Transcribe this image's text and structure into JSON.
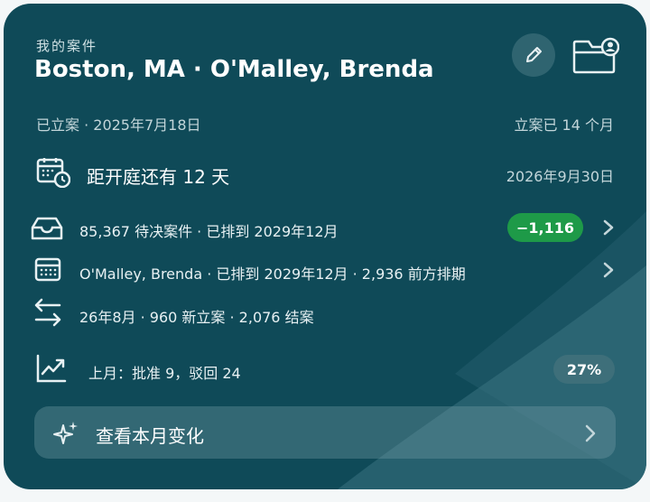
{
  "header": {
    "eyebrow": "我的案件",
    "title": "Boston, MA · O'Malley, Brenda",
    "icons": [
      "pencil-icon",
      "folder-person-icon"
    ]
  },
  "meta": {
    "filed": "已立案 · 2025年7月18日",
    "age": "立案已 14 个月"
  },
  "hearing": {
    "icon": "calendar-clock-icon",
    "countdown": "距开庭还有 12 天",
    "date": "2026年9月30日"
  },
  "rows": [
    {
      "icon": "inbox-tray-icon",
      "text": "85,367 待决案件 · 已排到 2029年12月",
      "badge": "−1,116",
      "badge_color": "#1e9a48",
      "has_chevron": true
    },
    {
      "icon": "calendar-icon",
      "text": "O'Malley, Brenda · 已排到 2029年12月 · 2,936 前方排期",
      "has_chevron": true
    },
    {
      "icon": "arrows-swap-icon",
      "text": "26年8月 · 960 新立案 · 2,076 结案",
      "has_chevron": false
    },
    {
      "icon": "trend-chart-icon",
      "text": "上月：批准 9，驳回 24",
      "badge": "27%",
      "badge_color": "#3e6f7a",
      "has_chevron": false
    }
  ],
  "action": {
    "icon": "sparkle-icon",
    "label": "查看本月变化"
  },
  "colors": {
    "card_bg": "#0f4a58",
    "accent_green": "#1e9a48",
    "page_bg": "#f4f7f8"
  }
}
